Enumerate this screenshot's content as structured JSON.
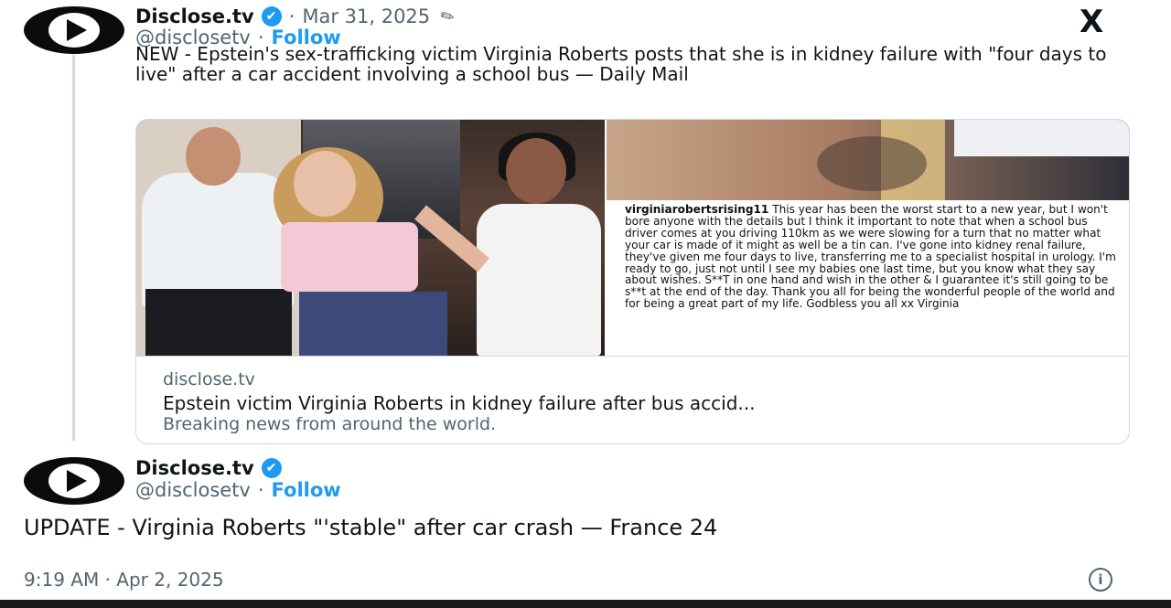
{
  "tweet1": {
    "display_name": "Disclose.tv",
    "handle": "@disclosetv",
    "date": "Mar 31, 2025",
    "follow_label": "Follow",
    "text": "NEW - Epstein's sex-trafficking victim Virginia Roberts posts that she is in kidney failure with \"four days to live\" after a car accident involving a school bus — Daily Mail",
    "card": {
      "domain": "disclose.tv",
      "title": "Epstein victim Virginia Roberts in kidney failure after bus accid...",
      "description": "Breaking news from around the world.",
      "instagram_user": "virginiarobertsrising11",
      "instagram_caption": "This year has been the worst start to a new year, but I won't bore anyone with the details but I think it important to note that when a school bus driver comes at you driving 110km as we were slowing for a turn that no matter what your car is made of it might as well be a tin can. I've gone into kidney renal failure, they've given me four days to live, transferring me to a specialist hospital in urology. I'm ready to go, just not until I see my babies one last time, but you know what they say about wishes. S**T in one hand and wish in the other & I guarantee it's still going to be s**t at the end of the day. Thank you all for being the wonderful people of the world and for being a great part of my life. Godbless you all xx Virginia"
    }
  },
  "tweet2": {
    "display_name": "Disclose.tv",
    "handle": "@disclosetv",
    "follow_label": "Follow",
    "text": "UPDATE - Virginia Roberts \"'stable\" after car crash — France 24",
    "timestamp": "9:19 AM · Apr 2, 2025"
  },
  "x_logo": "X",
  "separator": "·",
  "icons": {
    "verified": "verified-badge-icon",
    "grok": "grok-icon",
    "info": "info-icon"
  },
  "colors": {
    "accent": "#1d9bf0",
    "muted": "#536471",
    "text": "#0f1419",
    "border": "#cfd9de"
  }
}
